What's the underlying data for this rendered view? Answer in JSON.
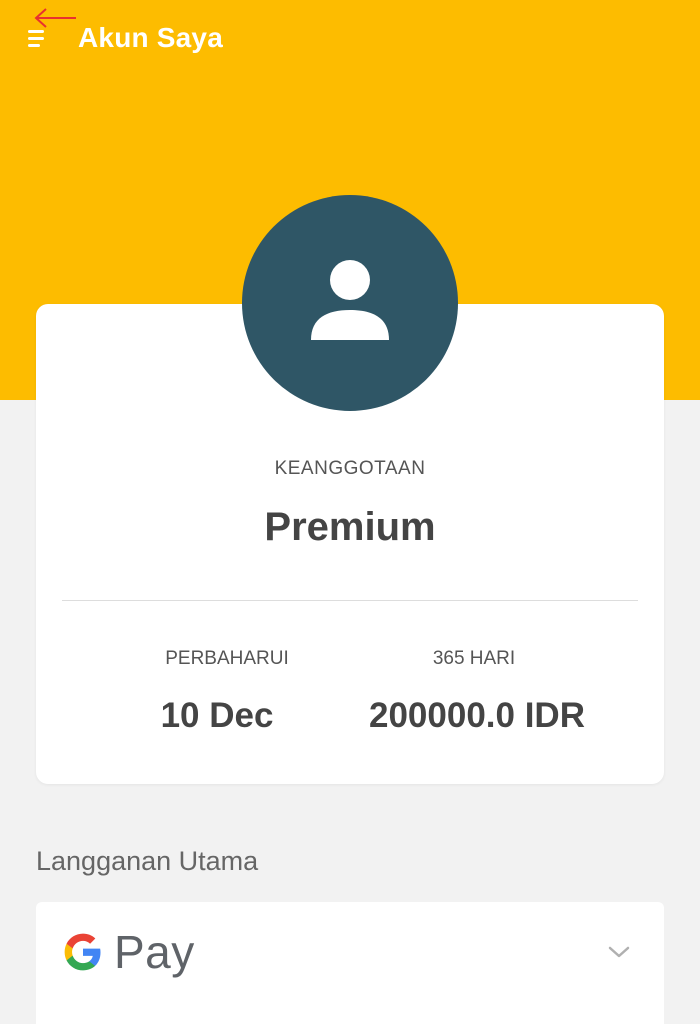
{
  "header": {
    "title": "Akun Saya",
    "menu_icon": "hamburger-menu-icon",
    "bg_color": "#fdbc00"
  },
  "profile": {
    "avatar_icon": "user-icon",
    "avatar_color": "#2f5666"
  },
  "membership": {
    "label": "KEANGGOTAAN",
    "value": "Premium"
  },
  "stats": {
    "renew_label": "PERBAHARUI",
    "renew_value": "10 Dec",
    "price_label": "365 HARI",
    "price_value": "200000.0 IDR"
  },
  "subscription": {
    "section_title": "Langganan Utama",
    "payment_method": "Pay",
    "payment_icon": "google-g-icon",
    "expand_icon": "chevron-down-icon"
  }
}
